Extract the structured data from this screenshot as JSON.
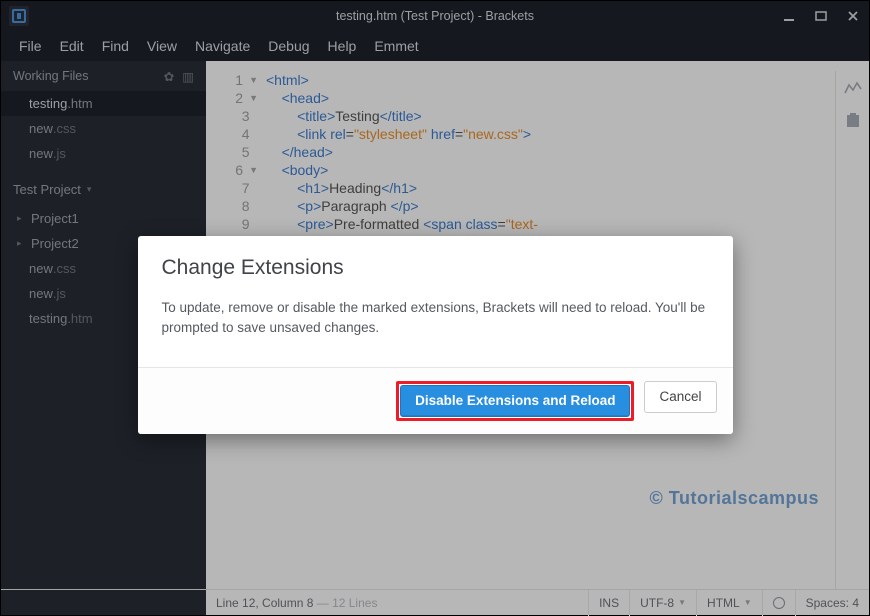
{
  "title": "testing.htm (Test Project) - Brackets",
  "menubar": [
    "File",
    "Edit",
    "Find",
    "View",
    "Navigate",
    "Debug",
    "Help",
    "Emmet"
  ],
  "sidebar": {
    "working_files_label": "Working Files",
    "working_files": [
      {
        "base": "testing",
        "ext": ".htm",
        "active": true
      },
      {
        "base": "new",
        "ext": ".css",
        "active": false
      },
      {
        "base": "new",
        "ext": ".js",
        "active": false
      }
    ],
    "project_label": "Test Project",
    "tree": [
      {
        "type": "folder",
        "label": "Project1"
      },
      {
        "type": "folder",
        "label": "Project2"
      },
      {
        "type": "file",
        "base": "new",
        "ext": ".css"
      },
      {
        "type": "file",
        "base": "new",
        "ext": ".js"
      },
      {
        "type": "file",
        "base": "testing",
        "ext": ".htm"
      }
    ]
  },
  "editor": {
    "lines": [
      {
        "n": 1,
        "fold": "▼",
        "html": "<span class='tag'>&lt;html&gt;</span>"
      },
      {
        "n": 2,
        "fold": "▼",
        "html": "    <span class='tag'>&lt;head&gt;</span>"
      },
      {
        "n": 3,
        "fold": "",
        "html": "        <span class='tag'>&lt;title&gt;</span><span class='txt'>Testing</span><span class='tag'>&lt;/title&gt;</span>"
      },
      {
        "n": 4,
        "fold": "",
        "html": "        <span class='tag'>&lt;link</span> <span class='attr'>rel</span>=<span class='str'>\"stylesheet\"</span> <span class='attr'>href</span>=<span class='str'>\"new.css\"</span><span class='tag'>&gt;</span>"
      },
      {
        "n": 5,
        "fold": "",
        "html": "    <span class='tag'>&lt;/head&gt;</span>"
      },
      {
        "n": 6,
        "fold": "▼",
        "html": "    <span class='tag'>&lt;body&gt;</span>"
      },
      {
        "n": 7,
        "fold": "",
        "html": "        <span class='tag'>&lt;h1&gt;</span><span class='txt'>Heading</span><span class='tag'>&lt;/h1&gt;</span>"
      },
      {
        "n": 8,
        "fold": "",
        "html": "        <span class='tag'>&lt;p&gt;</span><span class='txt'>Paragraph </span><span class='tag'>&lt;/p&gt;</span>"
      },
      {
        "n": 9,
        "fold": "",
        "html": "        <span class='tag'>&lt;pre&gt;</span><span class='txt'>Pre-formatted </span><span class='tag'>&lt;span</span> <span class='attr'>class</span>=<span class='str'>\"text-</span>"
      }
    ]
  },
  "watermark": "© Tutorialscampus",
  "statusbar": {
    "cursor": "Line 12, Column 8",
    "lines_suffix": " — 12 Lines",
    "ins": "INS",
    "enc": "UTF-8",
    "lang": "HTML",
    "spaces": "Spaces: 4"
  },
  "modal": {
    "title": "Change Extensions",
    "body": "To update, remove or disable the marked extensions, Brackets will need to reload. You'll be prompted to save unsaved changes.",
    "primary": "Disable Extensions and Reload",
    "cancel": "Cancel"
  }
}
